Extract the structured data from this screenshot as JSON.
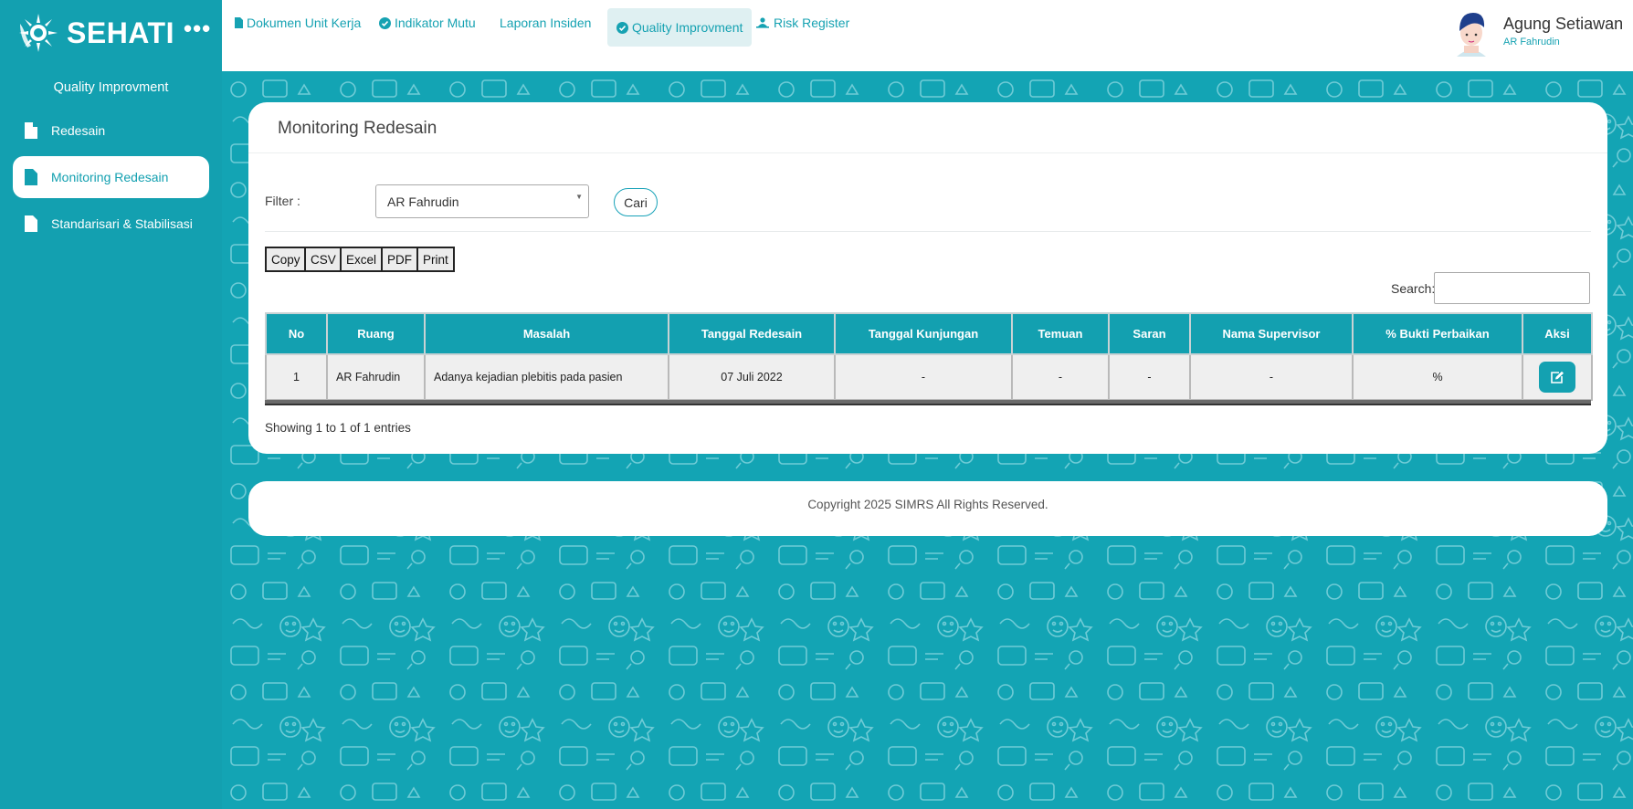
{
  "brand": {
    "name": "SEHATI",
    "menu_glyph": "•••"
  },
  "sidebar": {
    "heading": "Quality Improvment",
    "items": [
      {
        "label": "Redesain",
        "active": false
      },
      {
        "label": "Monitoring Redesain",
        "active": true
      },
      {
        "label": "Standarisari & Stabilisasi",
        "active": false
      }
    ]
  },
  "topnav": {
    "items": [
      {
        "label": "Dokumen Unit Kerja",
        "icon": "file-icon"
      },
      {
        "label": "Indikator Mutu",
        "icon": "check-circle-icon"
      },
      {
        "label": "Laporan Insiden",
        "icon": ""
      },
      {
        "label": "Quality Improvment",
        "icon": "check-circle-icon",
        "active": true
      },
      {
        "label": "Risk Register",
        "icon": "people-icon"
      }
    ]
  },
  "user": {
    "name": "Agung Setiawan",
    "unit": "AR Fahrudin"
  },
  "main": {
    "title": "Monitoring Redesain",
    "filter": {
      "label": "Filter :",
      "selected": "AR Fahrudin",
      "search_button": "Cari"
    },
    "export_buttons": [
      "Copy",
      "CSV",
      "Excel",
      "PDF",
      "Print"
    ],
    "search_label": "Search:",
    "table": {
      "headers": [
        "No",
        "Ruang",
        "Masalah",
        "Tanggal Redesain",
        "Tanggal Kunjungan",
        "Temuan",
        "Saran",
        "Nama Supervisor",
        "% Bukti Perbaikan",
        "Aksi"
      ],
      "rows": [
        {
          "no": "1",
          "ruang": "AR Fahrudin",
          "masalah": "Adanya kejadian plebitis pada pasien",
          "tanggal_redesain": "07 Juli 2022",
          "tanggal_kunjungan": "-",
          "temuan": "-",
          "saran": "-",
          "nama_supervisor": "-",
          "bukti": "%"
        }
      ]
    },
    "info": "Showing 1 to 1 of 1 entries"
  },
  "footer": {
    "text": "Copyright 2025 SIMRS All Rights Reserved."
  },
  "colors": {
    "primary": "#13a0b0",
    "background": "#13a4b4",
    "nav_active_bg": "#dff0f2"
  }
}
